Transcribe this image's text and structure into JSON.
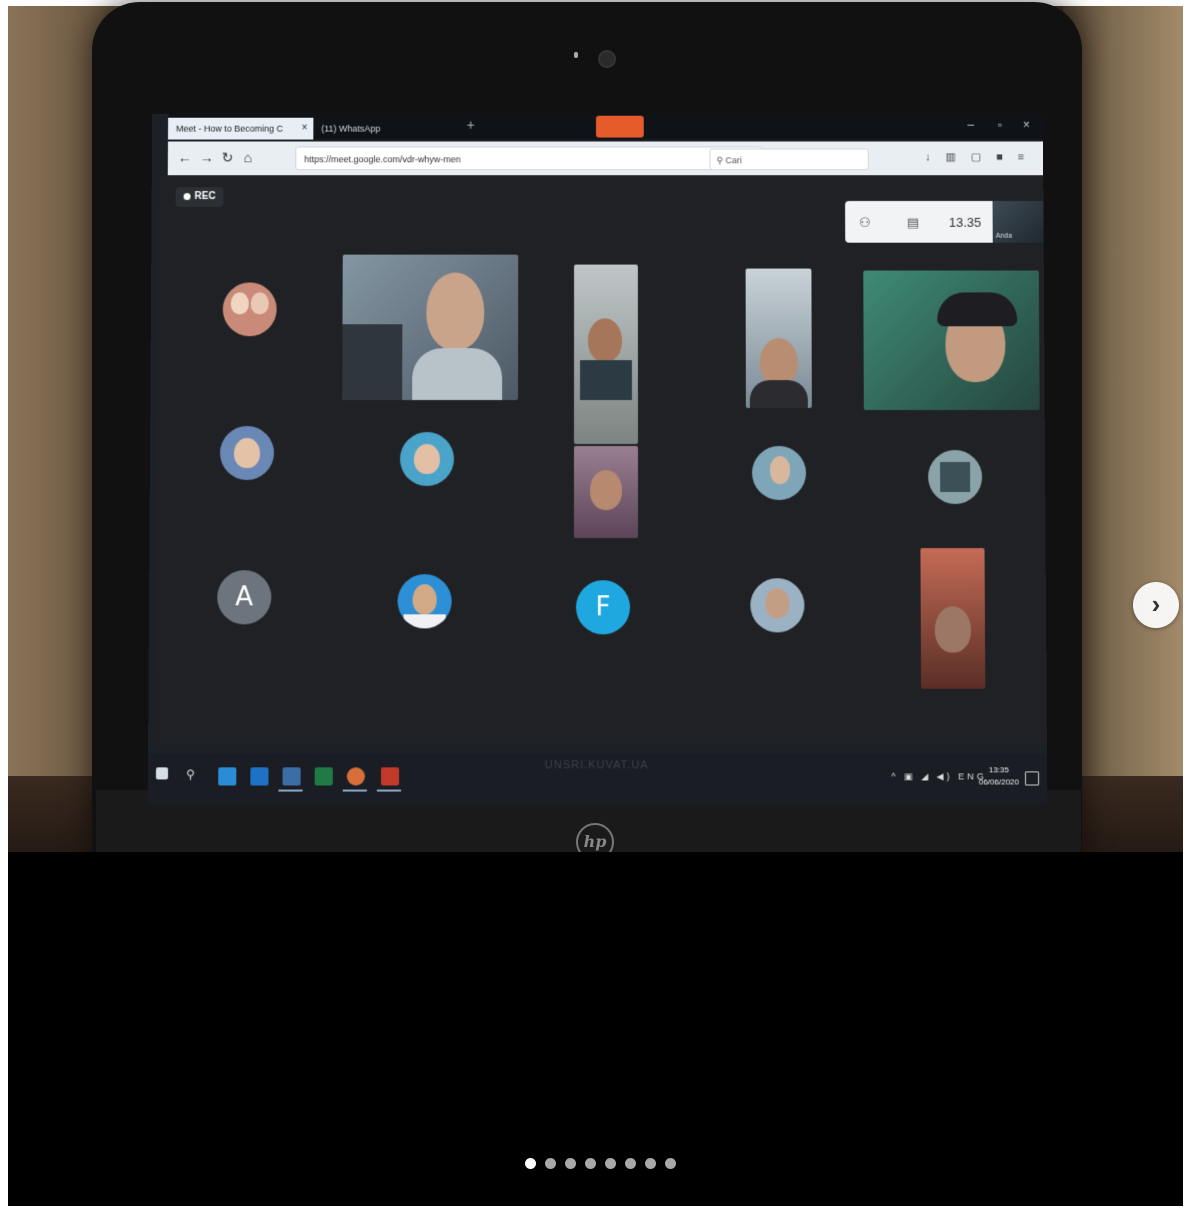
{
  "browser": {
    "tabs": [
      {
        "label": "Meet - How to Becoming C",
        "active": true
      },
      {
        "label": "(11) WhatsApp",
        "active": false
      }
    ],
    "new_tab": "+",
    "url": "https://meet.google.com/vdr-whyw-men",
    "search_placeholder": "Cari"
  },
  "meet": {
    "rec_label": "REC",
    "time": "13.35",
    "thumb_name": "Anda",
    "participants": [
      {
        "type": "avatar",
        "color": "#c98a7a"
      },
      {
        "type": "video",
        "color": "#6f7f8c"
      },
      {
        "type": "video",
        "color": "#8a8f88"
      },
      {
        "type": "video",
        "color": "#7a8a95"
      },
      {
        "type": "video",
        "color": "#3b6e63"
      },
      {
        "type": "avatar",
        "color": "#6a88b6"
      },
      {
        "type": "avatar",
        "color": "#4aa3c8"
      },
      {
        "type": "video",
        "color": "#7c5a74"
      },
      {
        "type": "avatar",
        "color": "#7fa6b8"
      },
      {
        "type": "avatar",
        "color": "#8aa3a8"
      },
      {
        "type": "letter",
        "letter": "A",
        "color": "#6c757d"
      },
      {
        "type": "avatar",
        "color": "#2d8fd6"
      },
      {
        "type": "letter",
        "letter": "F",
        "color": "#1fa8e0"
      },
      {
        "type": "avatar",
        "color": "#9ab2c4"
      },
      {
        "type": "video",
        "color": "#8b4a3c"
      }
    ]
  },
  "taskbar": {
    "watermark": "UNSRI.KUVAT.UA",
    "tray_lang": "ENG",
    "clock_time": "13:35",
    "clock_date": "06/06/2020"
  },
  "carousel": {
    "next_icon": "›",
    "dot_count": 8,
    "active_dot": 0
  }
}
